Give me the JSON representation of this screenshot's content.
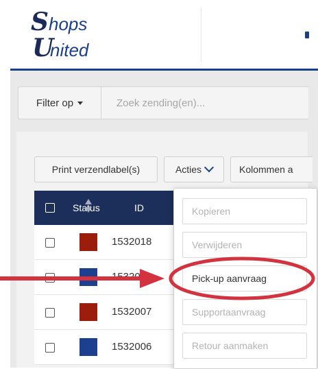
{
  "logo": {
    "letter1": "S",
    "text1": "hops",
    "letter2": "U",
    "text2": "nited"
  },
  "filter": {
    "button_label": "Filter op",
    "search_placeholder": "Zoek zending(en)..."
  },
  "toolbar": {
    "print_label": "Print verzendlabel(s)",
    "acties_label": "Acties",
    "kolommen_label": "Kolommen a"
  },
  "table": {
    "headers": {
      "status": "Status",
      "id": "ID"
    },
    "rows": [
      {
        "id": "1532018",
        "status_color": "#9b1d0c"
      },
      {
        "id": "1532011",
        "status_color": "#1c3f8e"
      },
      {
        "id": "1532007",
        "status_color": "#9b1d0c"
      },
      {
        "id": "1532006",
        "status_color": "#1c3f8e"
      }
    ]
  },
  "dropdown": {
    "items": [
      {
        "label": "Kopieren",
        "enabled": false
      },
      {
        "label": "Verwijderen",
        "enabled": false
      },
      {
        "label": "Pick-up aanvraag",
        "enabled": true
      },
      {
        "label": "Supportaanvraag",
        "enabled": false
      },
      {
        "label": "Retour aanmaken",
        "enabled": false
      }
    ]
  },
  "colors": {
    "brand": "#1b3f86",
    "table_header": "#1c2f5a",
    "annotation": "#d3333f"
  }
}
